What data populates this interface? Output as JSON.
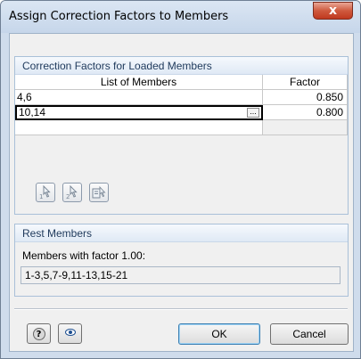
{
  "window": {
    "title": "Assign Correction Factors to Members",
    "close_label": "x"
  },
  "loaded_group": {
    "header": "Correction Factors for Loaded Members",
    "columns": [
      "List of Members",
      "Factor"
    ],
    "rows": [
      {
        "members": "4,6",
        "factor": "0.850"
      },
      {
        "members": "10,14",
        "factor": "0.800"
      }
    ],
    "ellipsis_label": "...",
    "tools": [
      "pick-1-icon",
      "pick-2-icon",
      "pick-list-icon"
    ]
  },
  "rest_group": {
    "header": "Rest Members",
    "label": "Members with factor 1.00:",
    "value": "1-3,5,7-9,11-13,15-21"
  },
  "buttons": {
    "ok": "OK",
    "cancel": "Cancel",
    "help_icon": "help-icon",
    "view_icon": "eye-icon"
  },
  "colors": {
    "frame": "#cfdcec",
    "group_header_text": "#1e395b",
    "close_button": "#c0391f"
  }
}
